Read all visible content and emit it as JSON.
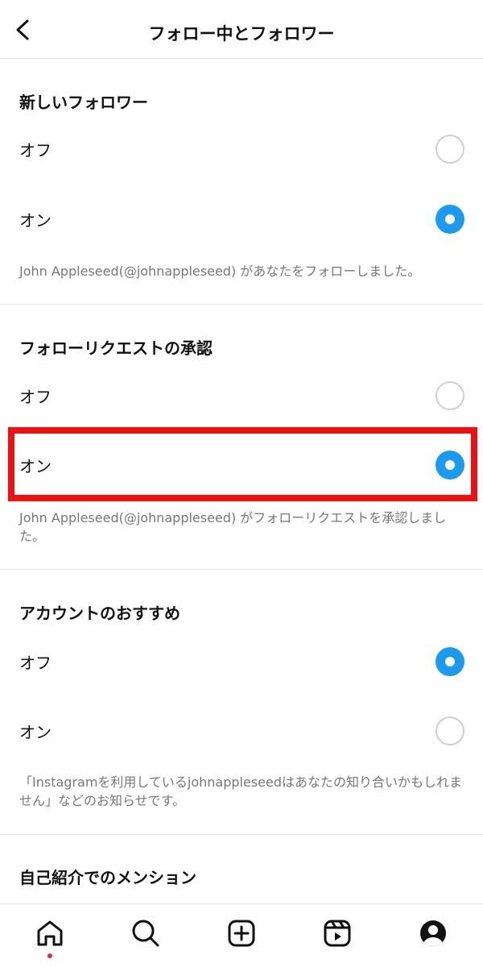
{
  "header": {
    "title": "フォロー中とフォロワー"
  },
  "sections": [
    {
      "title": "新しいフォロワー",
      "options": [
        {
          "label": "オフ",
          "selected": false
        },
        {
          "label": "オン",
          "selected": true
        }
      ],
      "description": "John Appleseed(@johnappleseed) があなたをフォローしました。"
    },
    {
      "title": "フォローリクエストの承認",
      "options": [
        {
          "label": "オフ",
          "selected": false
        },
        {
          "label": "オン",
          "selected": true
        }
      ],
      "description": "John Appleseed(@johnappleseed) がフォローリクエストを承認しました。"
    },
    {
      "title": "アカウントのおすすめ",
      "options": [
        {
          "label": "オフ",
          "selected": true
        },
        {
          "label": "オン",
          "selected": false
        }
      ],
      "description": "「Instagramを利用しているjohnappleseedはあなたの知り合いかもしれません」などのお知らせです。"
    },
    {
      "title": "自己紹介でのメンション"
    }
  ],
  "bottom_nav": {
    "items": [
      "home-icon",
      "search-icon",
      "create-icon",
      "reels-icon",
      "profile-icon"
    ],
    "active": "home-icon"
  },
  "colors": {
    "accent": "#1a9bf0",
    "highlight": "#ee1111",
    "notification_dot": "#ee2244"
  }
}
